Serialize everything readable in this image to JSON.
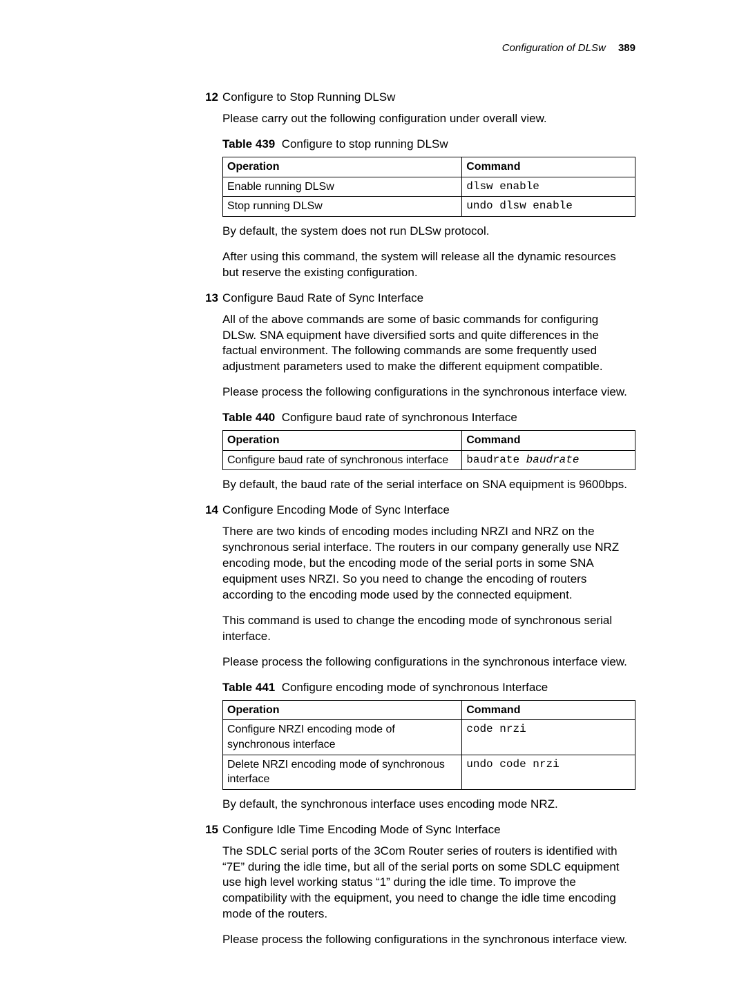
{
  "header": {
    "title": "Configuration of DLSw",
    "page": "389"
  },
  "s12": {
    "num": "12",
    "title": "Configure to Stop Running DLSw",
    "p1": "Please carry out the following configuration under overall view.",
    "caption_label": "Table 439",
    "caption_text": "Configure to stop running DLSw",
    "th_op": "Operation",
    "th_cmd": "Command",
    "r1_op": "Enable running DLSw",
    "r1_cmd": "dlsw enable",
    "r2_op": "Stop running DLSw",
    "r2_cmd": "undo dlsw enable",
    "p2": "By default, the system does not run DLSw protocol.",
    "p3": "After using this command, the system will release all the dynamic resources but reserve the existing configuration."
  },
  "s13": {
    "num": "13",
    "title": "Configure Baud Rate of Sync Interface",
    "p1": "All of the above commands are some of basic commands for configuring DLSw. SNA equipment have diversified sorts and quite differences in the factual environment. The following commands are some frequently used adjustment parameters used to make the different equipment compatible.",
    "p2": "Please process the following configurations in the synchronous interface view.",
    "caption_label": "Table 440",
    "caption_text": "Configure baud rate of synchronous Interface",
    "th_op": "Operation",
    "th_cmd": "Command",
    "r1_op": "Configure baud rate of synchronous interface",
    "r1_cmd_kw": "baudrate ",
    "r1_cmd_arg": "baudrate",
    "p3": "By default, the baud rate of the serial interface on SNA equipment is 9600bps."
  },
  "s14": {
    "num": "14",
    "title": "Configure Encoding Mode of Sync Interface",
    "p1": "There are two kinds of encoding modes including NRZI and NRZ on the synchronous serial interface. The routers in our company generally use NRZ encoding mode, but the encoding mode of the serial ports in some SNA equipment uses NRZI. So you need to change the encoding of routers according to the encoding mode used by the connected equipment.",
    "p2": "This command is used to change the encoding mode of synchronous serial interface.",
    "p3": "Please process the following configurations in the synchronous interface view.",
    "caption_label": "Table 441",
    "caption_text": "Configure encoding mode of synchronous Interface",
    "th_op": "Operation",
    "th_cmd": "Command",
    "r1_op": "Configure NRZI encoding mode of synchronous interface",
    "r1_cmd": "code nrzi",
    "r2_op": "Delete NRZI encoding mode of synchronous interface",
    "r2_cmd": "undo code nrzi",
    "p4": "By default, the synchronous interface uses encoding mode NRZ."
  },
  "s15": {
    "num": "15",
    "title": "Configure Idle Time Encoding Mode of Sync Interface",
    "p1": "The SDLC serial ports of the 3Com Router series of routers is identified with “7E” during the idle time, but all of the serial ports on some SDLC equipment use high level working status “1” during the idle time. To improve the compatibility with the equipment, you need to change the idle time encoding mode of the routers.",
    "p2": "Please process the following configurations in the synchronous interface view."
  }
}
